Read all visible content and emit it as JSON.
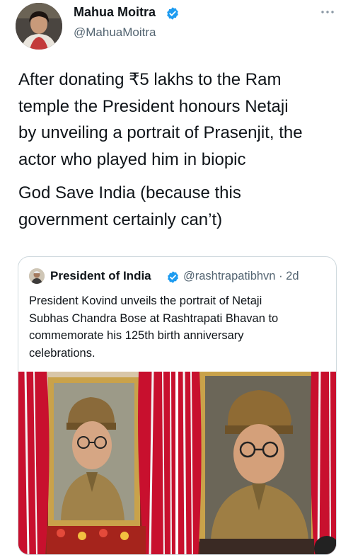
{
  "author": {
    "name": "Mahua Moitra",
    "handle": "@MahuaMoitra",
    "verified_color": "#1d9bf0"
  },
  "more_icon": "more-dots-icon",
  "tweet": {
    "paragraph1": "After donating ₹5 lakhs to the Ram\ntemple the President honours Netaji\nby unveiling a portrait of Prasenjit, the\nactor who played him in biopic",
    "paragraph2": "God Save India (because this\ngovernment certainly can’t)"
  },
  "quoted_tweet": {
    "name": "President of India",
    "handle": "@rashtrapatibhvn · 2d",
    "text": "President Kovind unveils the portrait of Netaji\nSubhas Chandra Bose at Rashtrapati Bhavan to\ncommemorate his 125th birth anniversary\ncelebrations."
  },
  "colors": {
    "text": "#0f1419",
    "secondary": "#536471",
    "border": "#cfd9de",
    "curtain_red": "#c8102e",
    "frame_gold": "#c9a24a"
  }
}
